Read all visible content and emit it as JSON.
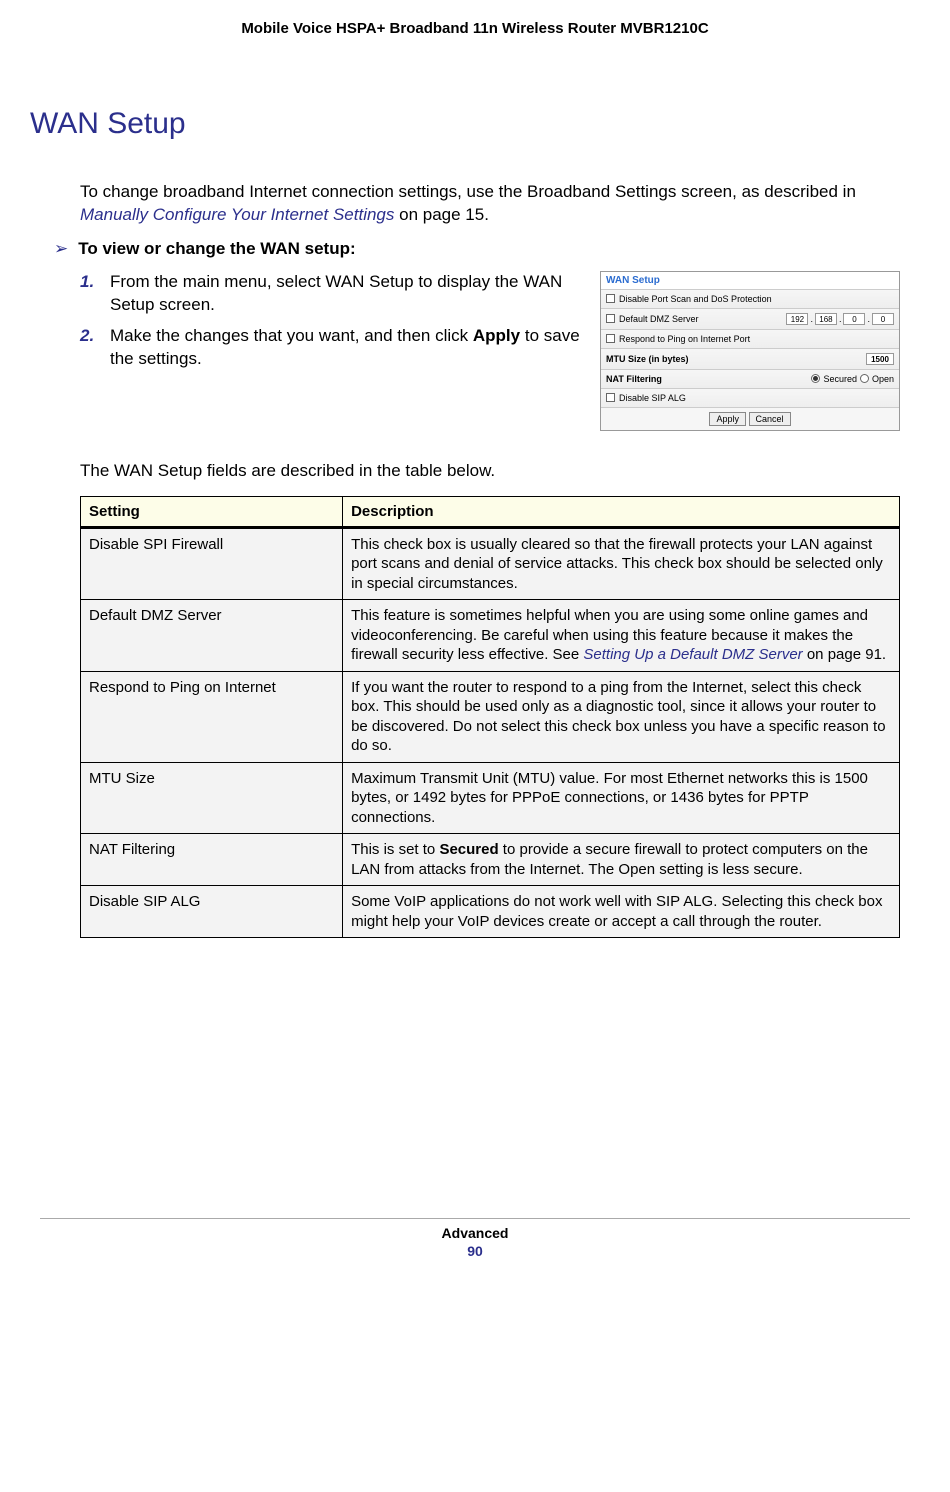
{
  "header": {
    "title": "Mobile Voice HSPA+ Broadband 11n Wireless Router MVBR1210C"
  },
  "section": {
    "title": "WAN Setup",
    "intro_prefix": "To change broadband Internet connection settings, use the Broadband Settings screen, as described in ",
    "intro_link": "Manually Configure Your Internet Settings",
    "intro_suffix": " on page 15.",
    "procedure_heading": "To view or change the WAN setup:",
    "steps": [
      {
        "num": "1.",
        "text": "From the main menu, select WAN Setup to display the WAN Setup screen."
      },
      {
        "num": "2.",
        "text_before": "Make the changes that you want, and then click ",
        "bold": "Apply",
        "text_after": " to save the settings."
      }
    ],
    "table_intro": "The WAN Setup fields are described in the table below."
  },
  "screenshot": {
    "title": "WAN Setup",
    "row1": "Disable Port Scan and DoS Protection",
    "row2": "Default DMZ Server",
    "ip": [
      "192",
      "168",
      "0",
      "0"
    ],
    "row3": "Respond to Ping on Internet Port",
    "row4_label": "MTU Size (in bytes)",
    "row4_value": "1500",
    "row5_label": "NAT Filtering",
    "row5_opt1": "Secured",
    "row5_opt2": "Open",
    "row6": "Disable SIP ALG",
    "apply": "Apply",
    "cancel": "Cancel"
  },
  "table": {
    "headers": {
      "setting": "Setting",
      "description": "Description"
    },
    "rows": [
      {
        "setting": "Disable SPI Firewall",
        "desc": "This check box is usually cleared so that the firewall protects your LAN against port scans and denial of service attacks. This check box should be selected only in special circumstances."
      },
      {
        "setting": "Default DMZ Server",
        "desc_before": "This feature is sometimes helpful when you are using some online games and videoconferencing. Be careful when using this feature because it makes the firewall security less effective. See ",
        "desc_link": "Setting Up a Default DMZ Server",
        "desc_after": " on page 91."
      },
      {
        "setting": "Respond to Ping on Internet",
        "desc": "If you want the router to respond to a ping from the Internet, select this check box. This should be used only as a diagnostic tool, since it allows your router to be discovered. Do not select this check box unless you have a specific reason to do so."
      },
      {
        "setting": "MTU Size",
        "desc": "Maximum Transmit Unit (MTU) value. For most Ethernet networks this is 1500 bytes, or 1492 bytes for PPPoE connections, or 1436 bytes for PPTP connections."
      },
      {
        "setting": "NAT Filtering",
        "desc_before": "This is set to ",
        "desc_bold": "Secured",
        "desc_after": " to provide a secure firewall to protect computers on the LAN from attacks from the Internet. The Open setting is less secure."
      },
      {
        "setting": "Disable SIP ALG",
        "desc": "Some VoIP applications do not work well with SIP ALG. Selecting this check box might help your VoIP devices create or accept a call through the router."
      }
    ]
  },
  "footer": {
    "section": "Advanced",
    "page": "90"
  }
}
